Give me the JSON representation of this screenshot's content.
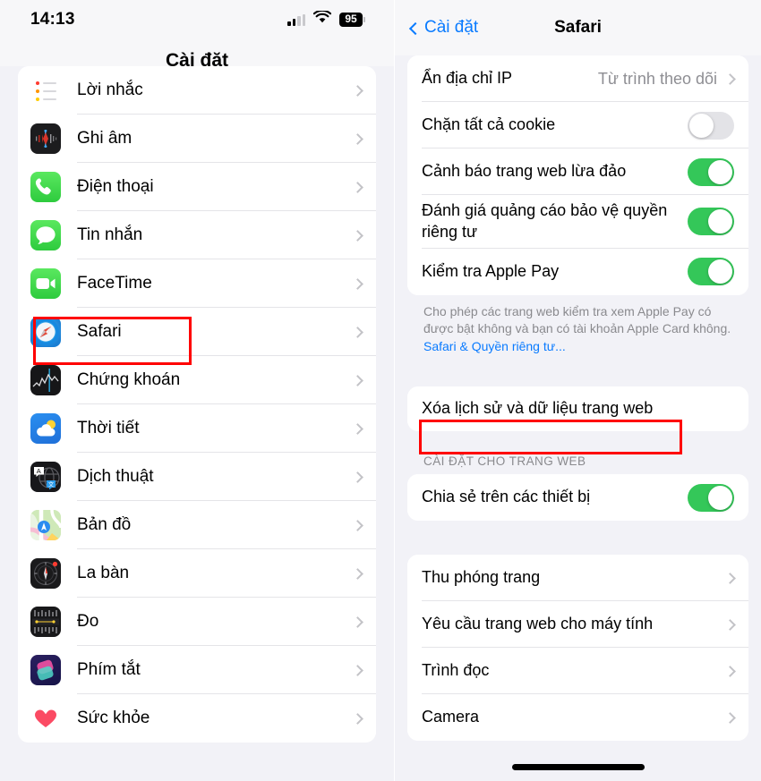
{
  "left": {
    "status": {
      "time": "14:13",
      "battery": "95",
      "signal_icon": "cellular-signal-icon",
      "wifi_icon": "wifi-icon",
      "battery_icon": "battery-icon"
    },
    "nav_title": "Cài đặt",
    "items": [
      {
        "label": "Lời nhắc",
        "icon": "reminders-app-icon",
        "key": "reminders"
      },
      {
        "label": "Ghi âm",
        "icon": "voice-memos-app-icon",
        "key": "voice"
      },
      {
        "label": "Điện thoại",
        "icon": "phone-app-icon",
        "key": "phone"
      },
      {
        "label": "Tin nhắn",
        "icon": "messages-app-icon",
        "key": "msg"
      },
      {
        "label": "FaceTime",
        "icon": "facetime-app-icon",
        "key": "ft"
      },
      {
        "label": "Safari",
        "icon": "safari-app-icon",
        "key": "safari"
      },
      {
        "label": "Chứng khoán",
        "icon": "stocks-app-icon",
        "key": "stocks"
      },
      {
        "label": "Thời tiết",
        "icon": "weather-app-icon",
        "key": "weather"
      },
      {
        "label": "Dịch thuật",
        "icon": "translate-app-icon",
        "key": "translate"
      },
      {
        "label": "Bản đồ",
        "icon": "maps-app-icon",
        "key": "maps"
      },
      {
        "label": "La bàn",
        "icon": "compass-app-icon",
        "key": "compass"
      },
      {
        "label": "Đo",
        "icon": "measure-app-icon",
        "key": "measure"
      },
      {
        "label": "Phím tắt",
        "icon": "shortcuts-app-icon",
        "key": "shortcuts"
      },
      {
        "label": "Sức khỏe",
        "icon": "health-app-icon",
        "key": "health"
      }
    ],
    "highlight": {
      "target": "Safari",
      "color": "#ff0000"
    }
  },
  "right": {
    "back_label": "Cài đặt",
    "title": "Safari",
    "group1": [
      {
        "label": "Ẩn địa chỉ IP",
        "value": "Từ trình theo dõi",
        "control": "chevron"
      },
      {
        "label": "Chặn tất cả cookie",
        "control": "toggle",
        "toggle": "off"
      },
      {
        "label": "Cảnh báo trang web lừa đảo",
        "control": "toggle",
        "toggle": "on"
      },
      {
        "label": "Đánh giá quảng cáo bảo vệ quyền riêng tư",
        "control": "toggle",
        "toggle": "on"
      },
      {
        "label": "Kiểm tra Apple Pay",
        "control": "toggle",
        "toggle": "on"
      }
    ],
    "footer_text": "Cho phép các trang web kiểm tra xem Apple Pay có được bật không và bạn có tài khoản Apple Card không.",
    "footer_link": "Safari & Quyền riêng tư...",
    "clear_action": "Xóa lịch sử và dữ liệu trang web",
    "section_header": "CÀI ĐẶT CHO TRANG WEB",
    "group2": [
      {
        "label": "Chia sẻ trên các thiết bị",
        "control": "toggle",
        "toggle": "on"
      }
    ],
    "group3": [
      {
        "label": "Thu phóng trang",
        "control": "chevron"
      },
      {
        "label": "Yêu cầu trang web cho máy tính",
        "control": "chevron"
      },
      {
        "label": "Trình đọc",
        "control": "chevron"
      },
      {
        "label": "Camera",
        "control": "chevron"
      }
    ],
    "highlight": {
      "target": "Xóa lịch sử và dữ liệu trang web",
      "color": "#ff0000"
    }
  },
  "colors": {
    "accent_blue": "#0a7bff",
    "toggle_on_green": "#34c759",
    "toggle_off_gray": "#e3e3e7",
    "panel_bg": "#f2f2f7",
    "card_bg": "#ffffff",
    "annotation_red": "#ff0000"
  }
}
